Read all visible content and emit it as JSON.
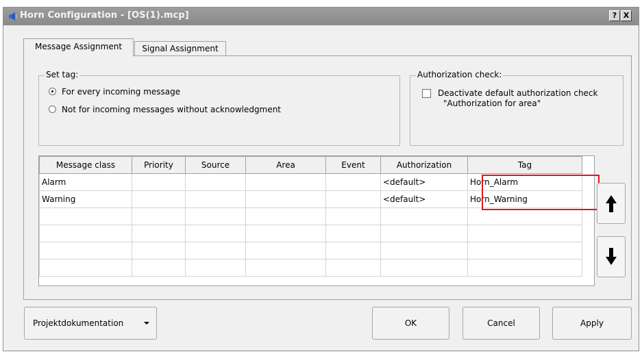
{
  "window": {
    "title": "Horn Configuration - [OS(1).mcp]",
    "help_glyph": "?",
    "close_glyph": "X"
  },
  "tabs": [
    {
      "label": "Message Assignment",
      "active": true
    },
    {
      "label": "Signal Assignment",
      "active": false
    }
  ],
  "set_tag": {
    "legend": "Set tag:",
    "options": [
      {
        "label": "For every incoming message",
        "checked": true
      },
      {
        "label": "Not for incoming messages without acknowledgment",
        "checked": false
      }
    ]
  },
  "authorization_check": {
    "legend": "Authorization check:",
    "checkbox_line1": "Deactivate default authorization check",
    "checkbox_line2": "\"Authorization for area\"",
    "checked": false
  },
  "grid": {
    "columns": [
      "Message class",
      "Priority",
      "Source",
      "Area",
      "Event",
      "Authorization",
      "Tag"
    ],
    "rows": [
      [
        "Alarm",
        "",
        "",
        "",
        "",
        "<default>",
        "Horn_Alarm"
      ],
      [
        "Warning",
        "",
        "",
        "",
        "",
        "<default>",
        "Horn_Warning"
      ],
      [
        "",
        "",
        "",
        "",
        "",
        "",
        ""
      ],
      [
        "",
        "",
        "",
        "",
        "",
        "",
        ""
      ],
      [
        "",
        "",
        "",
        "",
        "",
        "",
        ""
      ],
      [
        "",
        "",
        "",
        "",
        "",
        "",
        ""
      ]
    ],
    "highlight_color": "#e3151c"
  },
  "icons": {
    "move_up": "arrow-up-icon",
    "move_down": "arrow-down-icon"
  },
  "buttons": {
    "projekt": "Projektdokumentation",
    "ok": "OK",
    "cancel": "Cancel",
    "apply": "Apply"
  },
  "colors": {
    "title_bar": "#8f8f8f",
    "dialog_background": "#f0f0f0"
  }
}
